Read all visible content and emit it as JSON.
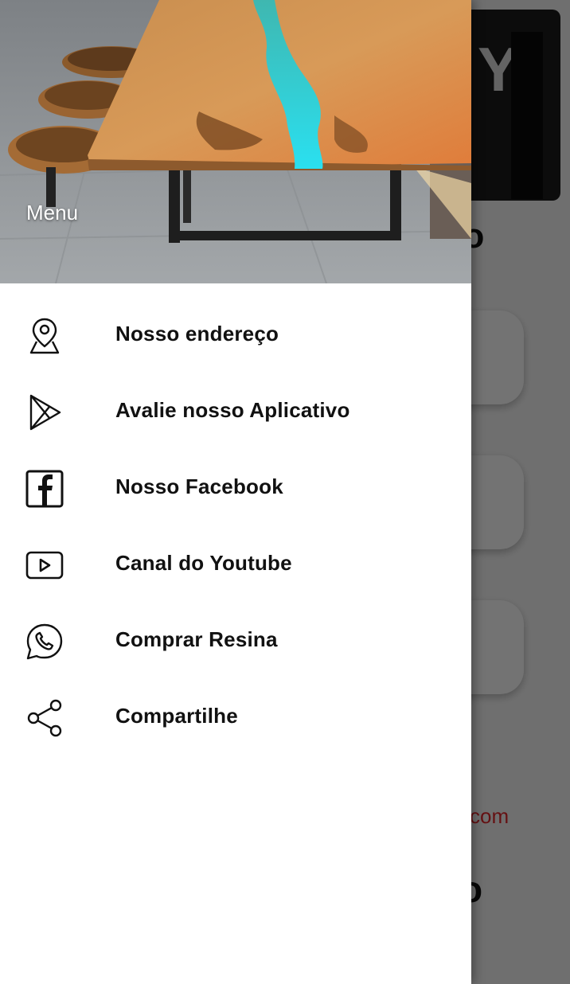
{
  "background_app": {
    "logo_letter": "Y",
    "heading_fragment": "nto",
    "email_fragment": "com",
    "heading2_fragment": "o"
  },
  "drawer": {
    "title": "Menu",
    "items": [
      {
        "label": "Nosso endereço",
        "icon": "map-pin-icon"
      },
      {
        "label": "Avalie nosso Aplicativo",
        "icon": "play-store-icon"
      },
      {
        "label": "Nosso Facebook",
        "icon": "facebook-icon"
      },
      {
        "label": "Canal do Youtube",
        "icon": "youtube-icon"
      },
      {
        "label": "Comprar Resina",
        "icon": "whatsapp-icon"
      },
      {
        "label": "Compartilhe",
        "icon": "share-icon"
      }
    ]
  },
  "colors": {
    "accent_red": "#e0262b",
    "scrim": "rgba(0,0,0,0.55)",
    "drawer_bg": "#ffffff",
    "text": "#111111"
  }
}
